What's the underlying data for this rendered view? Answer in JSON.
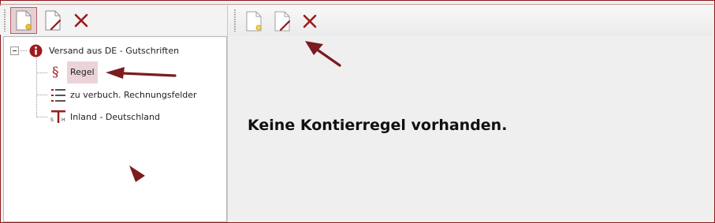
{
  "left_toolbar": {
    "buttons": [
      {
        "icon": "new-document-icon"
      },
      {
        "icon": "edit-document-icon"
      },
      {
        "icon": "delete-icon"
      }
    ]
  },
  "right_toolbar": {
    "buttons": [
      {
        "icon": "new-document-icon"
      },
      {
        "icon": "edit-document-icon"
      },
      {
        "icon": "delete-icon"
      }
    ]
  },
  "tree": {
    "root": {
      "label": "Versand aus DE - Gutschriften",
      "icon": "info-icon",
      "expander": "⊟"
    },
    "children": [
      {
        "label": "Regel",
        "icon": "paragraph-icon",
        "glyph": "§",
        "selected": true
      },
      {
        "label": "zu verbuch. Rechnungsfelder",
        "icon": "list-icon"
      },
      {
        "label": "Inland - Deutschland",
        "icon": "tax-icon"
      }
    ]
  },
  "content": {
    "message": "Keine Kontierregel vorhanden."
  },
  "colors": {
    "accent": "#8b1a1a",
    "selected_bg": "#ecd3d7",
    "arrow": "#7a1c20"
  }
}
